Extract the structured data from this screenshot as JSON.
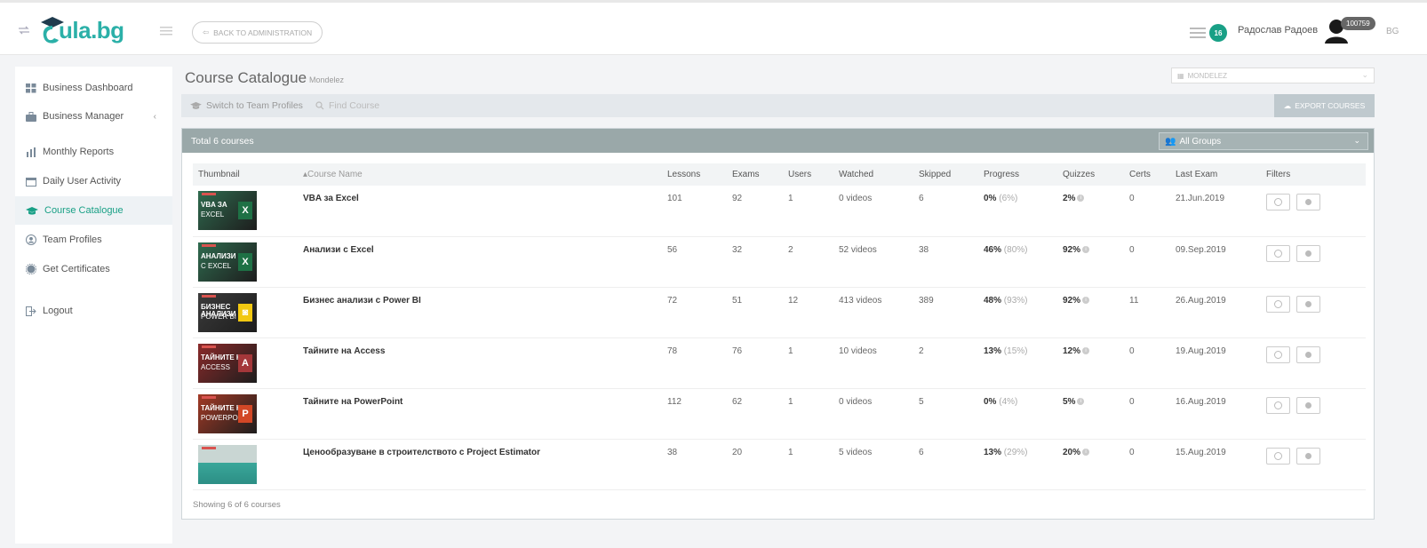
{
  "header": {
    "logo_text": "ula.bg",
    "back_label": "BACK TO ADMINISTRATION",
    "notification_count": "16",
    "user_name": "Радослав Радоев",
    "user_id": "100759",
    "language": "BG"
  },
  "sidebar": {
    "items": [
      {
        "label": "Business Dashboard",
        "icon": "grid-icon"
      },
      {
        "label": "Business Manager",
        "icon": "briefcase-icon"
      },
      {
        "label": "Monthly Reports",
        "icon": "chart-icon"
      },
      {
        "label": "Daily User Activity",
        "icon": "calendar-icon"
      },
      {
        "label": "Course Catalogue",
        "icon": "graduation-cap-icon"
      },
      {
        "label": "Team Profiles",
        "icon": "user-icon"
      },
      {
        "label": "Get Certificates",
        "icon": "certificate-icon"
      },
      {
        "label": "Logout",
        "icon": "logout-icon"
      }
    ]
  },
  "page": {
    "title": "Course Catalogue",
    "company": "Mondelez",
    "company_select": "MONDELEZ"
  },
  "toolbar": {
    "switch_label": "Switch to Team Profiles",
    "search_placeholder": "Find Course",
    "export_label": "EXPORT COURSES"
  },
  "panel": {
    "total": "Total 6 courses",
    "groups": "All Groups",
    "footer": "Showing 6 of 6 courses"
  },
  "table": {
    "columns": [
      "Thumbnail",
      "Course Name",
      "Lessons",
      "Exams",
      "Users",
      "Watched",
      "Skipped",
      "Progress",
      "Quizzes",
      "Certs",
      "Last Exam",
      "Filters"
    ],
    "rows": [
      {
        "name": "VBA за Excel",
        "lessons": "101",
        "exams": "92",
        "users": "1",
        "watched": "0 videos",
        "skipped": "6",
        "progress": "0%",
        "progress_sub": "(6%)",
        "quizzes": "2%",
        "certs": "0",
        "last_exam": "21.Jun.2019",
        "thumb": {
          "line1": "VBA ЗА",
          "line2": "EXCEL",
          "badge": "X",
          "bg": "#2f6b4f",
          "badge_bg": "#1e7145"
        }
      },
      {
        "name": "Анализи с Excel",
        "lessons": "56",
        "exams": "32",
        "users": "2",
        "watched": "52 videos",
        "skipped": "38",
        "progress": "46%",
        "progress_sub": "(80%)",
        "quizzes": "92%",
        "certs": "0",
        "last_exam": "09.Sep.2019",
        "thumb": {
          "line1": "АНАЛИЗИ",
          "line2": "С EXCEL",
          "badge": "X",
          "bg": "#2f6b4f",
          "badge_bg": "#1e7145"
        }
      },
      {
        "name": "Бизнес анализи с Power BI",
        "lessons": "72",
        "exams": "51",
        "users": "12",
        "watched": "413 videos",
        "skipped": "389",
        "progress": "48%",
        "progress_sub": "(93%)",
        "quizzes": "92%",
        "certs": "11",
        "last_exam": "26.Aug.2019",
        "thumb": {
          "line1": "БИЗНЕС АНАЛИЗИ С",
          "line2": "POWER BI",
          "badge": "◙",
          "bg": "#3b3b3b",
          "badge_bg": "#f2c811"
        }
      },
      {
        "name": "Тайните на Access",
        "lessons": "78",
        "exams": "76",
        "users": "1",
        "watched": "10 videos",
        "skipped": "2",
        "progress": "13%",
        "progress_sub": "(15%)",
        "quizzes": "12%",
        "certs": "0",
        "last_exam": "19.Aug.2019",
        "thumb": {
          "line1": "ТАЙНИТЕ НА",
          "line2": "ACCESS",
          "badge": "A",
          "bg": "#8a2a2a",
          "badge_bg": "#a4373a"
        }
      },
      {
        "name": "Тайните на PowerPoint",
        "lessons": "112",
        "exams": "62",
        "users": "1",
        "watched": "0 videos",
        "skipped": "5",
        "progress": "0%",
        "progress_sub": "(4%)",
        "quizzes": "5%",
        "certs": "0",
        "last_exam": "16.Aug.2019",
        "thumb": {
          "line1": "ТАЙНИТЕ НА",
          "line2": "POWERPOINT",
          "badge": "P",
          "bg": "#a33a26",
          "badge_bg": "#d24726"
        }
      },
      {
        "name": "Ценообразуване в строителството с Project Estimator",
        "lessons": "38",
        "exams": "20",
        "users": "1",
        "watched": "5 videos",
        "skipped": "6",
        "progress": "13%",
        "progress_sub": "(29%)",
        "quizzes": "20%",
        "certs": "0",
        "last_exam": "15.Aug.2019",
        "thumb": {
          "line1": "",
          "line2": "",
          "badge": "",
          "bg": "#3aa79a",
          "badge_bg": "#3aa79a"
        }
      }
    ]
  },
  "colors": {
    "accent": "#19a086",
    "panel_header": "#9aa8a9"
  }
}
